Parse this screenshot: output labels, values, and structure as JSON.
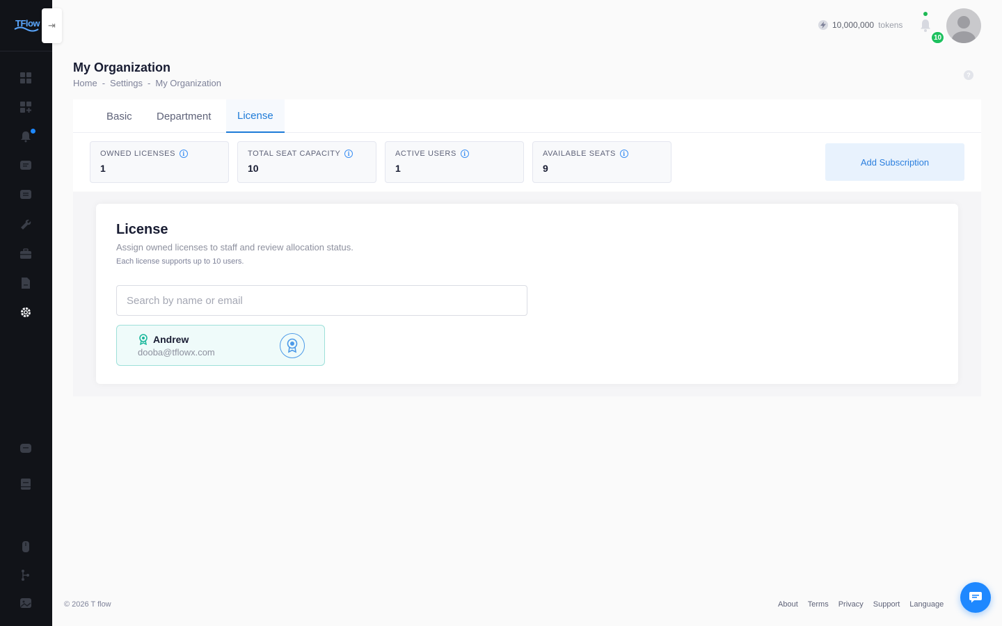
{
  "brand": {
    "logo_text": "TFlow",
    "accent": "#1e7bd8"
  },
  "sidebar": {
    "items": [
      {
        "name": "dashboard-icon"
      },
      {
        "name": "add-widget-icon"
      },
      {
        "name": "bell-icon",
        "has_dot": true
      },
      {
        "name": "chat-icon"
      },
      {
        "name": "message-icon"
      },
      {
        "name": "wrench-icon"
      },
      {
        "name": "briefcase-icon"
      },
      {
        "name": "document-icon"
      },
      {
        "name": "settings-icon",
        "active": true
      },
      {
        "name": "comment-icon"
      },
      {
        "name": "book-icon"
      },
      {
        "name": "mouse-icon"
      },
      {
        "name": "tree-icon"
      },
      {
        "name": "gallery-icon"
      }
    ],
    "collapse_glyph": "⇥"
  },
  "header": {
    "tokens_value": "10,000,000",
    "tokens_unit": "tokens",
    "notification_count": "10"
  },
  "page": {
    "title": "My Organization",
    "breadcrumb": [
      "Home",
      "Settings",
      "My Organization"
    ],
    "help_glyph": "?"
  },
  "tabs": [
    {
      "label": "Basic",
      "active": false
    },
    {
      "label": "Department",
      "active": false
    },
    {
      "label": "License",
      "active": true
    }
  ],
  "stats": [
    {
      "label": "OWNED LICENSES",
      "value": "1"
    },
    {
      "label": "TOTAL SEAT CAPACITY",
      "value": "10"
    },
    {
      "label": "ACTIVE USERS",
      "value": "1"
    },
    {
      "label": "AVAILABLE SEATS",
      "value": "9"
    }
  ],
  "add_subscription_label": "Add Subscription",
  "license": {
    "title": "License",
    "description": "Assign owned licenses to staff and review allocation status.",
    "note": "Each license supports up to 10 users.",
    "search_placeholder": "Search by name or email",
    "users": [
      {
        "name": "Andrew",
        "email": "dooba@tflowx.com"
      }
    ]
  },
  "footer": {
    "copyright": "© 2026 T flow",
    "links": [
      "About",
      "Terms",
      "Privacy",
      "Support",
      "Language"
    ]
  }
}
